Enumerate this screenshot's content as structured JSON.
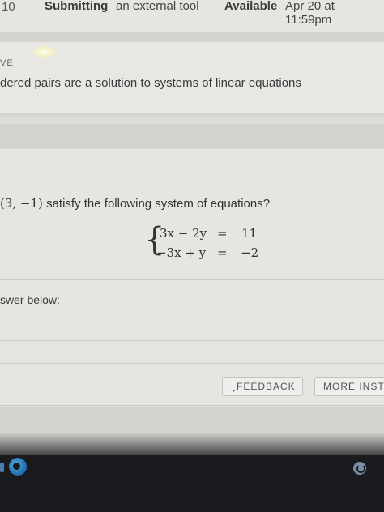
{
  "header": {
    "item_number": "10",
    "submitting_label": "Submitting",
    "submission_type": "an external tool",
    "available_label": "Available",
    "available_date": "Apr 20 at 11:59pm"
  },
  "assignment": {
    "small_label": "VE",
    "title": "dered pairs are a solution to systems of linear equations"
  },
  "question": {
    "point": "(3, −1)",
    "prompt": " satisfy the following system of equations?",
    "equations": [
      {
        "lhs": "3x − 2y",
        "eq": "=",
        "rhs": "11"
      },
      {
        "lhs": "−3x + y",
        "eq": "=",
        "rhs": "−2"
      }
    ],
    "answer_label": "swer below:"
  },
  "buttons": {
    "feedback": "FEEDBACK",
    "more": "MORE INSTRU"
  },
  "colors": {
    "panel": "#e6e5e2",
    "background": "#d4d3d0",
    "taskbar": "#1a1b1e"
  }
}
